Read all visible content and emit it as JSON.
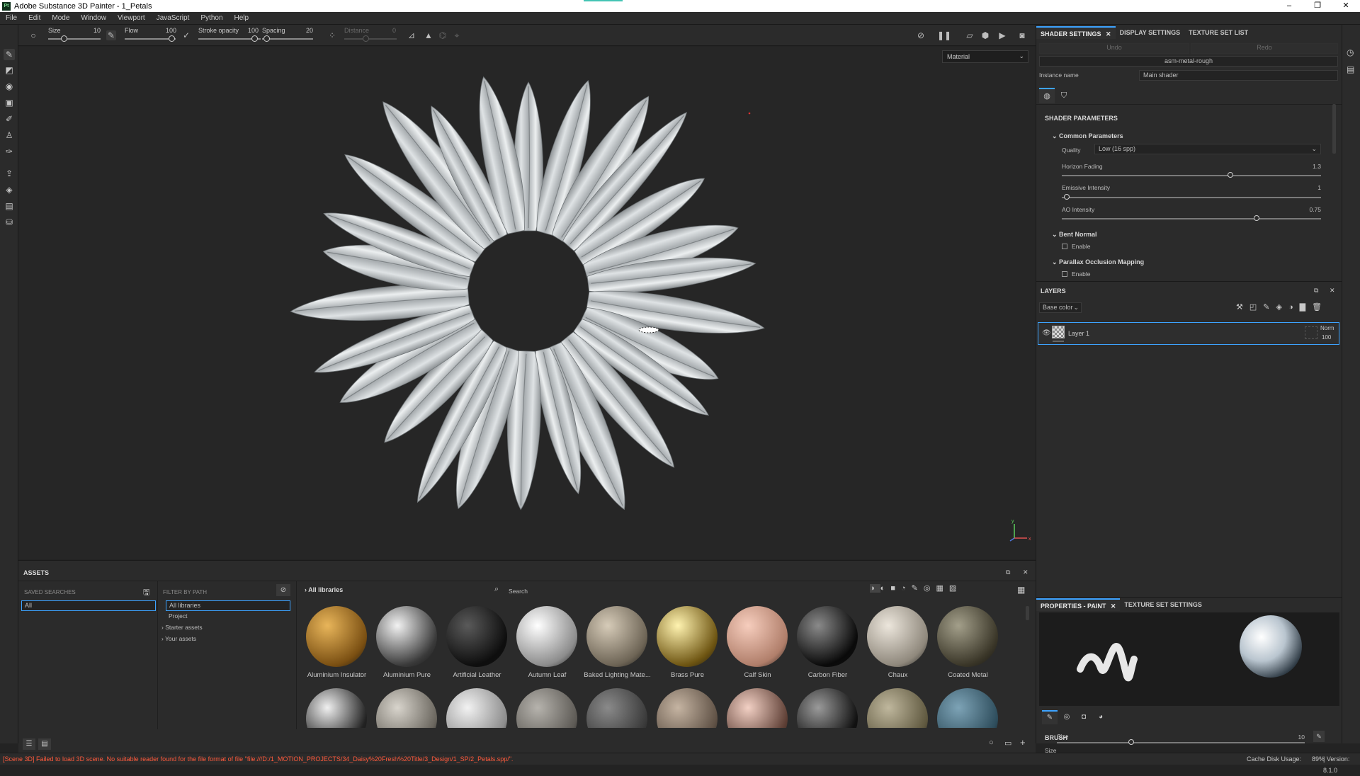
{
  "window": {
    "title": "Adobe Substance 3D Painter - 1_Petals",
    "app_icon_text": "Pt",
    "controls": [
      "–",
      "❐",
      "✕"
    ]
  },
  "menu": [
    "File",
    "Edit",
    "Mode",
    "Window",
    "Viewport",
    "JavaScript",
    "Python",
    "Help"
  ],
  "toolbar": {
    "size_label": "Size",
    "size_value": "10",
    "flow_label": "Flow",
    "flow_value": "100",
    "stroke_opacity_label": "Stroke opacity",
    "stroke_opacity_value": "100",
    "spacing_label": "Spacing",
    "spacing_value": "20",
    "distance_label": "Distance",
    "distance_value": "0"
  },
  "viewport": {
    "material_mode": "Material",
    "axis_labels": {
      "y": "y",
      "x": "x"
    }
  },
  "shader_settings": {
    "tabs": [
      {
        "label": "SHADER SETTINGS",
        "active": true
      },
      {
        "label": "DISPLAY SETTINGS",
        "active": false
      },
      {
        "label": "TEXTURE SET LIST",
        "active": false
      }
    ],
    "undo": "Undo",
    "redo": "Redo",
    "shader_name": "asm-metal-rough",
    "instance_label": "Instance name",
    "instance_value": "Main shader",
    "parameters_header": "SHADER PARAMETERS",
    "common_header": "Common Parameters",
    "quality_label": "Quality",
    "quality_value": "Low (16 spp)",
    "horizon_fading_label": "Horizon Fading",
    "horizon_fading_value": "1.3",
    "horizon_fading_fraction": 0.65,
    "emissive_label": "Emissive Intensity",
    "emissive_value": "1",
    "emissive_fraction": 0.02,
    "ao_label": "AO Intensity",
    "ao_value": "0.75",
    "ao_fraction": 0.75,
    "bent_normal_header": "Bent Normal",
    "bent_normal_enable": "Enable",
    "pom_header": "Parallax Occlusion Mapping",
    "pom_enable": "Enable"
  },
  "layers": {
    "title": "LAYERS",
    "channel": "Base color",
    "items": [
      {
        "name": "Layer 1",
        "blend": "Norm",
        "opacity": "100"
      }
    ]
  },
  "properties": {
    "tabs": [
      {
        "label": "PROPERTIES - PAINT",
        "active": true
      },
      {
        "label": "TEXTURE SET SETTINGS",
        "active": false
      }
    ],
    "brush_header": "BRUSH",
    "size_label": "Size",
    "size_sub_label": "Size",
    "size_value": "10"
  },
  "assets": {
    "title": "ASSETS",
    "saved_searches_label": "SAVED SEARCHES",
    "saved_search_value": "All",
    "filter_by_path_label": "FILTER BY PATH",
    "paths": [
      "All libraries",
      "Project",
      "Starter assets",
      "Your assets"
    ],
    "breadcrumb": "All libraries",
    "search_placeholder": "Search",
    "row1": [
      {
        "name": "Aluminium Insulator",
        "color_a": "#e8b55a",
        "color_b": "#7a4f12"
      },
      {
        "name": "Aluminium Pure",
        "color_a": "#f2f2f2",
        "color_b": "#3a3a3a"
      },
      {
        "name": "Artificial Leather",
        "color_a": "#5a5a5a",
        "color_b": "#0e0e0e"
      },
      {
        "name": "Autumn Leaf",
        "color_a": "#ffffff",
        "color_b": "#8c8c8c"
      },
      {
        "name": "Baked Lighting Mate...",
        "color_a": "#d6cbb8",
        "color_b": "#6d6455"
      },
      {
        "name": "Brass Pure",
        "color_a": "#fff3b0",
        "color_b": "#6e5512"
      },
      {
        "name": "Calf Skin",
        "color_a": "#f6cdbd",
        "color_b": "#b07e6a"
      },
      {
        "name": "Carbon Fiber",
        "color_a": "#8a8a8a",
        "color_b": "#0a0a0a"
      },
      {
        "name": "Chaux",
        "color_a": "#ece6dc",
        "color_b": "#8f887c"
      },
      {
        "name": "Coated Metal",
        "color_a": "#a39f8a",
        "color_b": "#3a3628"
      }
    ],
    "row2_colors": [
      {
        "color_a": "#f0f0f0",
        "color_b": "#222222"
      },
      {
        "color_a": "#d8d4cc",
        "color_b": "#6a665e"
      },
      {
        "color_a": "#f2f2f2",
        "color_b": "#8c8c8c"
      },
      {
        "color_a": "#b6b3ad",
        "color_b": "#5d5a55"
      },
      {
        "color_a": "#8a8a8a",
        "color_b": "#3a3a3a"
      },
      {
        "color_a": "#c5b4a2",
        "color_b": "#5f5145"
      },
      {
        "color_a": "#f2d0c4",
        "color_b": "#5e3f35"
      },
      {
        "color_a": "#9a9a9a",
        "color_b": "#111111"
      },
      {
        "color_a": "#bfb79d",
        "color_b": "#5f583f"
      },
      {
        "color_a": "#7da3b6",
        "color_b": "#2e4d5c"
      }
    ]
  },
  "status": {
    "error": "[Scene 3D] Failed to load 3D scene. No suitable reader found for the file format of file \"file:///D:/1_MOTION_PROJECTS/34_Daisy%20Fresh%20Title/3_Design/1_SP/2_Petals.spp/\".",
    "cache": "Cache Disk Usage:",
    "cache_value": "89%",
    "version": "| Version: 8.1.0"
  },
  "colors": {
    "accent": "#3da3ff",
    "error_text": "#ff5a3c",
    "panel_bg": "#2b2b2b",
    "viewport_bg": "#262626"
  }
}
